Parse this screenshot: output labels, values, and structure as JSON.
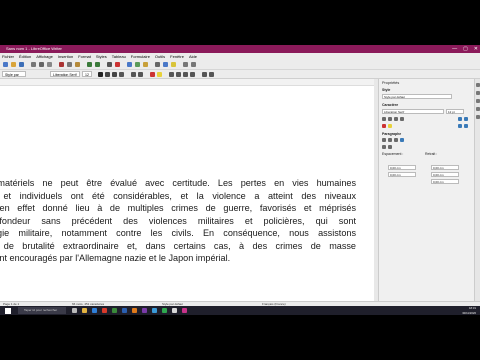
{
  "window": {
    "title": "Sans nom 1 - LibreOffice Writer",
    "minimize": "—",
    "maximize": "▢",
    "close": "✕"
  },
  "menu": [
    "Fichier",
    "Édition",
    "Affichage",
    "Insertion",
    "Format",
    "Styles",
    "Tableau",
    "Formulaire",
    "Outils",
    "Fenêtre",
    "Aide"
  ],
  "toolbar": {
    "paragraph_style": "Style par défaut",
    "font_name": "Liberation Serif",
    "font_size": "12"
  },
  "document": {
    "lines": [
      "images matériels ne peut être évalué avec certitude. Les pertes en vies humaines",
      "collectifs et individuels ont été considérables, et la violence a atteint des niveaux",
      "onflit a en effet donné lieu à de multiples crimes de guerre, favorisés et méprisés",
      "une profondeur sans précédent des violences militaires et policières, qui sont",
      "e stratégie militaire, notamment contre les civils. En conséquence, nous assistons",
      "récédent de brutalité extraordinaire et, dans certains cas, à des crimes de masse",
      "culièrement encouragés par l'Allemagne nazie et le Japon impérial."
    ]
  },
  "sidebar": {
    "title": "Propriétés",
    "style_section": "Style",
    "style_value": "Style par défaut",
    "char_section": "Caractère",
    "font_value": "Liberation Serif",
    "size_value": "12 pt",
    "para_section": "Paragraphe",
    "spacing_label": "Espacement :",
    "indent_label": "Retrait :",
    "spacing_values": [
      "0,00 cm",
      "0,00 cm"
    ],
    "indent_values": [
      "0,00 cm",
      "0,00 cm",
      "0,00 cm"
    ]
  },
  "statusbar": {
    "page": "Page 1 de 1",
    "words": "66 mots, 451 caractères",
    "style": "Style par défaut",
    "language": "Français (France)"
  },
  "taskbar": {
    "search_placeholder": "Taper ici pour rechercher",
    "time": "18:31",
    "date": "30/11/2020"
  }
}
